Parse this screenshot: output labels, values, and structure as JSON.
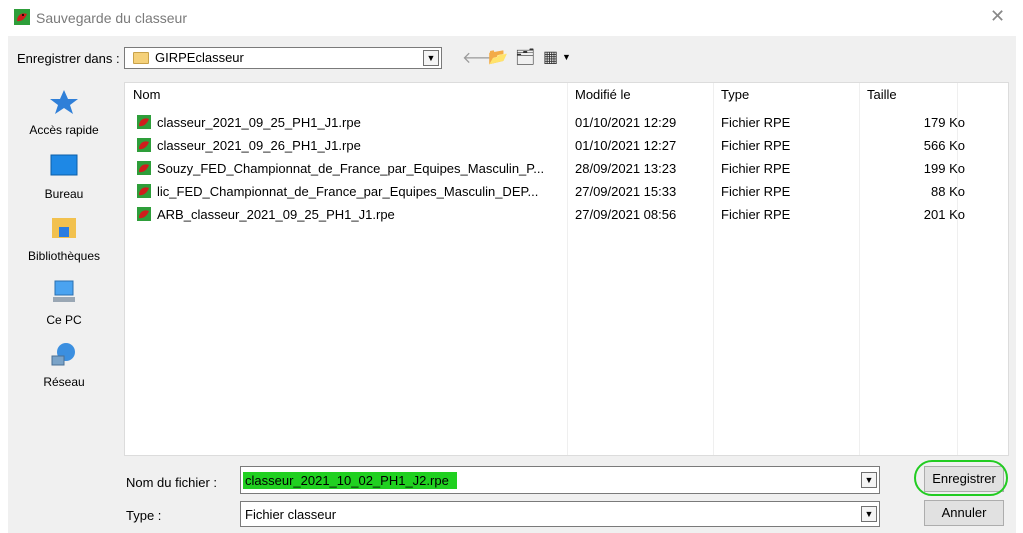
{
  "window": {
    "title": "Sauvegarde du classeur",
    "close_glyph": "✕"
  },
  "location": {
    "label": "Enregistrer dans :",
    "value": "GIRPEclasseur"
  },
  "toolbar": {
    "back_glyph": "🡐",
    "up_glyph": "📂",
    "new_folder_glyph": "🗂",
    "view_glyph": "▦"
  },
  "places": [
    {
      "label": "Accès rapide",
      "icon": "star-icon"
    },
    {
      "label": "Bureau",
      "icon": "desktop-icon"
    },
    {
      "label": "Bibliothèques",
      "icon": "libraries-icon"
    },
    {
      "label": "Ce PC",
      "icon": "computer-icon"
    },
    {
      "label": "Réseau",
      "icon": "network-icon"
    }
  ],
  "columns": {
    "name": "Nom",
    "modified": "Modifié le",
    "type": "Type",
    "size": "Taille"
  },
  "files": [
    {
      "name": "classeur_2021_09_25_PH1_J1.rpe",
      "modified": "01/10/2021 12:29",
      "type": "Fichier RPE",
      "size": "179 Ko"
    },
    {
      "name": "classeur_2021_09_26_PH1_J1.rpe",
      "modified": "01/10/2021 12:27",
      "type": "Fichier RPE",
      "size": "566 Ko"
    },
    {
      "name": "Souzy_FED_Championnat_de_France_par_Equipes_Masculin_P...",
      "modified": "28/09/2021 13:23",
      "type": "Fichier RPE",
      "size": "199 Ko"
    },
    {
      "name": "lic_FED_Championnat_de_France_par_Equipes_Masculin_DEP...",
      "modified": "27/09/2021 15:33",
      "type": "Fichier RPE",
      "size": "88 Ko"
    },
    {
      "name": "ARB_classeur_2021_09_25_PH1_J1.rpe",
      "modified": "27/09/2021 08:56",
      "type": "Fichier RPE",
      "size": "201 Ko"
    }
  ],
  "filename": {
    "label": "Nom du fichier :",
    "value": "classeur_2021_10_02_PH1_J2.rpe"
  },
  "filetype": {
    "label": "Type :",
    "value": "Fichier classeur"
  },
  "buttons": {
    "save": "Enregistrer",
    "cancel": "Annuler"
  },
  "colors": {
    "highlight": "#20d020",
    "annotation_ring": "#22cc22"
  }
}
